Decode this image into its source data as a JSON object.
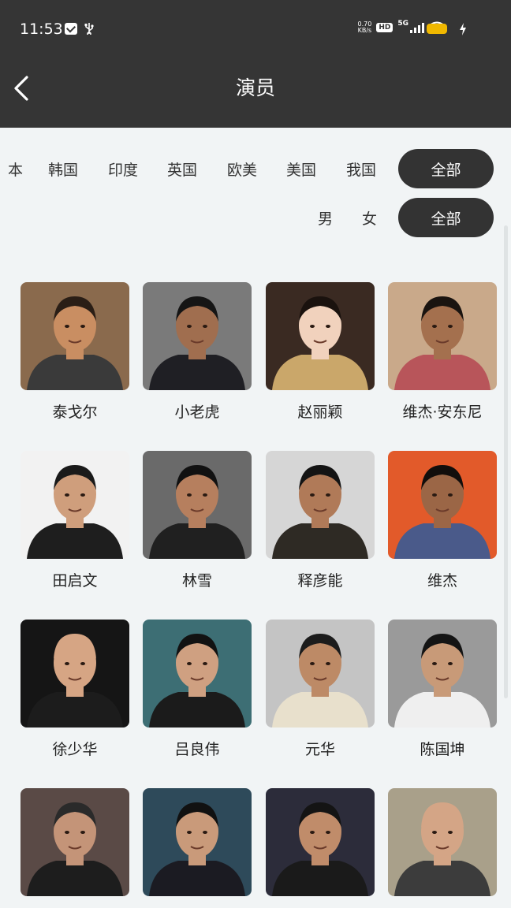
{
  "status_bar": {
    "time": "11:53",
    "net_speed_value": "0.70",
    "net_speed_unit": "KB/s",
    "hd_label": "HD",
    "network_label": "5G",
    "battery_color": "#f0b800"
  },
  "header": {
    "title": "演员",
    "back_icon": "chevron-left-icon"
  },
  "region_filter": {
    "items": [
      "本",
      "韩国",
      "印度",
      "英国",
      "欧美",
      "美国",
      "我国"
    ],
    "selected": "全部"
  },
  "gender_filter": {
    "items": [
      "男",
      "女"
    ],
    "selected": "全部"
  },
  "actors": [
    {
      "name": "泰戈尔",
      "bg": "#8a6a4d",
      "skin": "#c98e62",
      "cloth": "#3a3a3a",
      "hair": "#2a1e16"
    },
    {
      "name": "小老虎",
      "bg": "#7a7a7a",
      "skin": "#a06e4f",
      "cloth": "#1f1f24",
      "hair": "#151515"
    },
    {
      "name": "赵丽颖",
      "bg": "#3a2a22",
      "skin": "#f1d2bd",
      "cloth": "#caa76a",
      "hair": "#1a120e"
    },
    {
      "name": "维杰·安东尼",
      "bg": "#c9a98a",
      "skin": "#a4704e",
      "cloth": "#b8555a",
      "hair": "#1a1410"
    },
    {
      "name": "田启文",
      "bg": "#f2f2f2",
      "skin": "#cf9e7c",
      "cloth": "#1e1e1e",
      "hair": "#1a1a1a"
    },
    {
      "name": "林雪",
      "bg": "#6a6a6a",
      "skin": "#b67f5e",
      "cloth": "#202020",
      "hair": "#111111"
    },
    {
      "name": "释彦能",
      "bg": "#d6d6d6",
      "skin": "#b07a58",
      "cloth": "#2e2a24",
      "hair": "#141414"
    },
    {
      "name": "维杰",
      "bg": "#e25a2a",
      "skin": "#9b6646",
      "cloth": "#4a5a8a",
      "hair": "#120e0c"
    },
    {
      "name": "徐少华",
      "bg": "#151515",
      "skin": "#d6a584",
      "cloth": "#1c1c1c",
      "hair": "#d6a584"
    },
    {
      "name": "吕良伟",
      "bg": "#3d6e74",
      "skin": "#cfa081",
      "cloth": "#1b1b1b",
      "hair": "#121212"
    },
    {
      "name": "元华",
      "bg": "#c4c4c4",
      "skin": "#bd8a66",
      "cloth": "#e8e0cc",
      "hair": "#1c1c1c"
    },
    {
      "name": "陈国坤",
      "bg": "#9a9a9a",
      "skin": "#c89a78",
      "cloth": "#efefef",
      "hair": "#141414"
    },
    {
      "name": "",
      "bg": "#5a4a46",
      "skin": "#c49478",
      "cloth": "#1d1d1d",
      "hair": "#2a2a2a"
    },
    {
      "name": "",
      "bg": "#2e4a5a",
      "skin": "#c99a7a",
      "cloth": "#1b1b22",
      "hair": "#111111"
    },
    {
      "name": "",
      "bg": "#2c2c3a",
      "skin": "#c08c6a",
      "cloth": "#1a1a1a",
      "hair": "#141414"
    },
    {
      "name": "",
      "bg": "#a9a08a",
      "skin": "#d4a586",
      "cloth": "#3c3c3c",
      "hair": "#d4a586"
    }
  ]
}
